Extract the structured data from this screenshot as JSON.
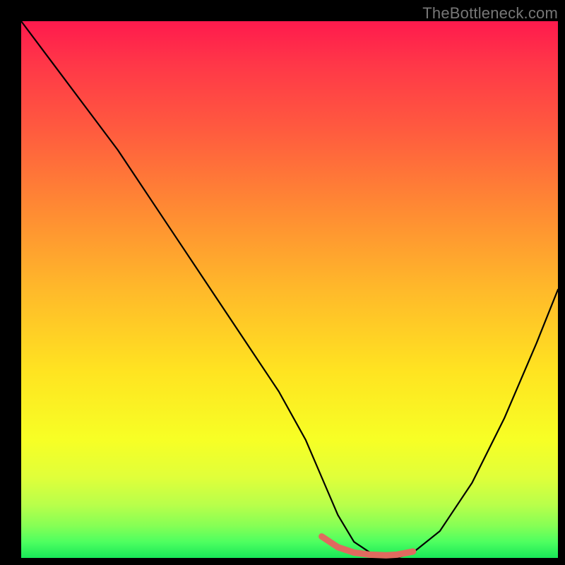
{
  "watermark": "TheBottleneck.com",
  "chart_data": {
    "type": "line",
    "title": "",
    "xlabel": "",
    "ylabel": "",
    "xlim": [
      0,
      100
    ],
    "ylim": [
      0,
      100
    ],
    "series": [
      {
        "name": "black-curve",
        "x": [
          0,
          6,
          12,
          18,
          24,
          30,
          36,
          42,
          48,
          53,
          56,
          59,
          62,
          65,
          68,
          70,
          73,
          78,
          84,
          90,
          96,
          100
        ],
        "y": [
          100,
          92,
          84,
          76,
          67,
          58,
          49,
          40,
          31,
          22,
          15,
          8,
          3,
          1,
          0,
          0,
          1,
          5,
          14,
          26,
          40,
          50
        ]
      },
      {
        "name": "red-valley-segment",
        "x": [
          56,
          59,
          62,
          65,
          68,
          70,
          73
        ],
        "y": [
          4,
          2,
          1,
          0.6,
          0.5,
          0.6,
          1.2
        ]
      }
    ],
    "gradient_stops": [
      {
        "pos": 0,
        "color": "#ff1a4d"
      },
      {
        "pos": 50,
        "color": "#ffe321"
      },
      {
        "pos": 100,
        "color": "#18e858"
      }
    ]
  }
}
